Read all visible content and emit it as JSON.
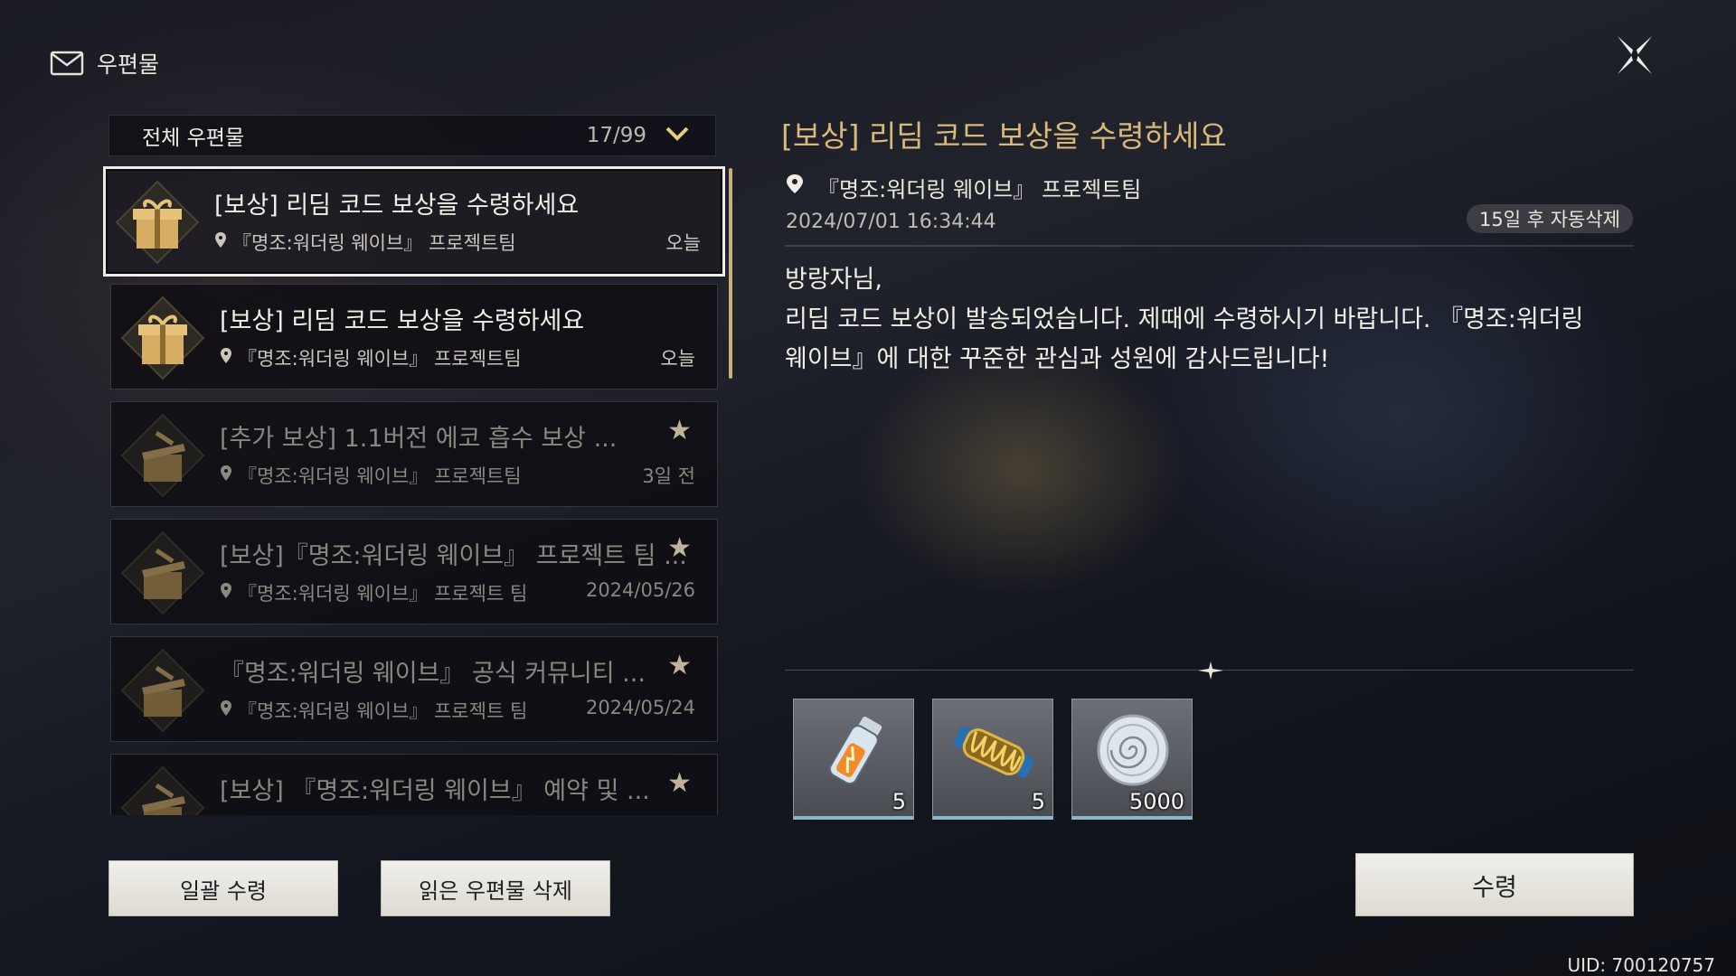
{
  "header": {
    "title": "우편물",
    "close_icon": "close-icon"
  },
  "filter": {
    "label": "전체 우편물",
    "count": "17/99"
  },
  "mails": [
    {
      "title": "[보상] 리딤 코드 보상을 수령하세요",
      "sender": "『명조:워더링 웨이브』 프로젝트팀",
      "date": "오늘",
      "starred": false,
      "selected": true,
      "read": false,
      "icon": "gift-box-icon"
    },
    {
      "title": "[보상] 리딤 코드 보상을 수령하세요",
      "sender": "『명조:워더링 웨이브』 프로젝트팀",
      "date": "오늘",
      "starred": false,
      "selected": false,
      "read": false,
      "icon": "gift-box-icon"
    },
    {
      "title": "[추가 보상] 1.1버전 에코 흡수 보상 ...",
      "sender": "『명조:워더링 웨이브』 프로젝트팀",
      "date": "3일 전",
      "starred": true,
      "selected": false,
      "read": true,
      "icon": "opened-box-icon"
    },
    {
      "title": "[보상]『명조:워더링 웨이브』 프로젝트 팀 ...",
      "sender": "『명조:워더링 웨이브』 프로젝트 팀",
      "date": "2024/05/26",
      "starred": true,
      "selected": false,
      "read": true,
      "icon": "opened-box-icon"
    },
    {
      "title": "『명조:워더링 웨이브』 공식 커뮤니티 ...",
      "sender": "『명조:워더링 웨이브』 프로젝트 팀",
      "date": "2024/05/24",
      "starred": true,
      "selected": false,
      "read": true,
      "icon": "opened-box-icon"
    },
    {
      "title": "[보상] 『명조:워더링 웨이브』 예약 및 ...",
      "sender": "",
      "date": "",
      "starred": true,
      "selected": false,
      "read": true,
      "icon": "opened-box-icon"
    }
  ],
  "star_glyph": "★",
  "detail": {
    "title": "[보상] 리딤 코드 보상을 수령하세요",
    "sender": "『명조:워더링 웨이브』 프로젝트팀",
    "datetime": "2024/07/01 16:34:44",
    "auto_delete": "15일 후 자동삭제",
    "body_greeting": "방랑자님,",
    "body_line1": "리딤 코드 보상이 발송되었습니다. 제때에 수령하시기 바랍니다. 『명조:워더링",
    "body_line2": "웨이브』에 대한 꾸준한 관심과 성원에 감사드립니다!"
  },
  "rewards": [
    {
      "icon": "resonance-potion-icon",
      "qty": "5"
    },
    {
      "icon": "energy-core-icon",
      "qty": "5"
    },
    {
      "icon": "shell-credit-icon",
      "qty": "5000"
    }
  ],
  "buttons": {
    "claim_all": "일괄 수령",
    "delete_read": "읽은 우편물 삭제",
    "receive": "수령"
  },
  "uid": "UID: 700120757",
  "colors": {
    "accent_gold": "#d9b978",
    "scroll_gold": "#c8b07a",
    "selected_border": "#efede6"
  }
}
